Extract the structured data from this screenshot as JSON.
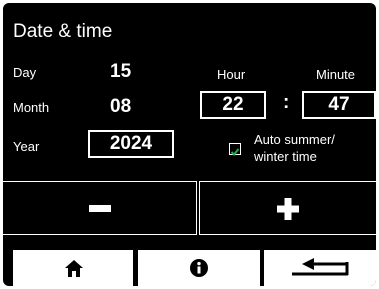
{
  "header": {
    "title": "Date & time"
  },
  "date": {
    "day_label": "Day",
    "day_value": "15",
    "month_label": "Month",
    "month_value": "08",
    "year_label": "Year",
    "year_value": "2024"
  },
  "time": {
    "hour_label": "Hour",
    "minute_label": "Minute",
    "hour_value": "22",
    "separator": ":",
    "minute_value": "47"
  },
  "dst": {
    "label_line1": "Auto summer/",
    "label_line2": "winter time",
    "checked": true
  },
  "controls": {
    "minus_icon": "minus-icon",
    "plus_icon": "plus-icon"
  },
  "nav": {
    "home_icon": "home-icon",
    "info_icon": "info-icon",
    "back_icon": "return-arrow-icon"
  },
  "colors": {
    "background": "#000000",
    "foreground": "#ffffff",
    "checkbox": "#2aa84a"
  }
}
